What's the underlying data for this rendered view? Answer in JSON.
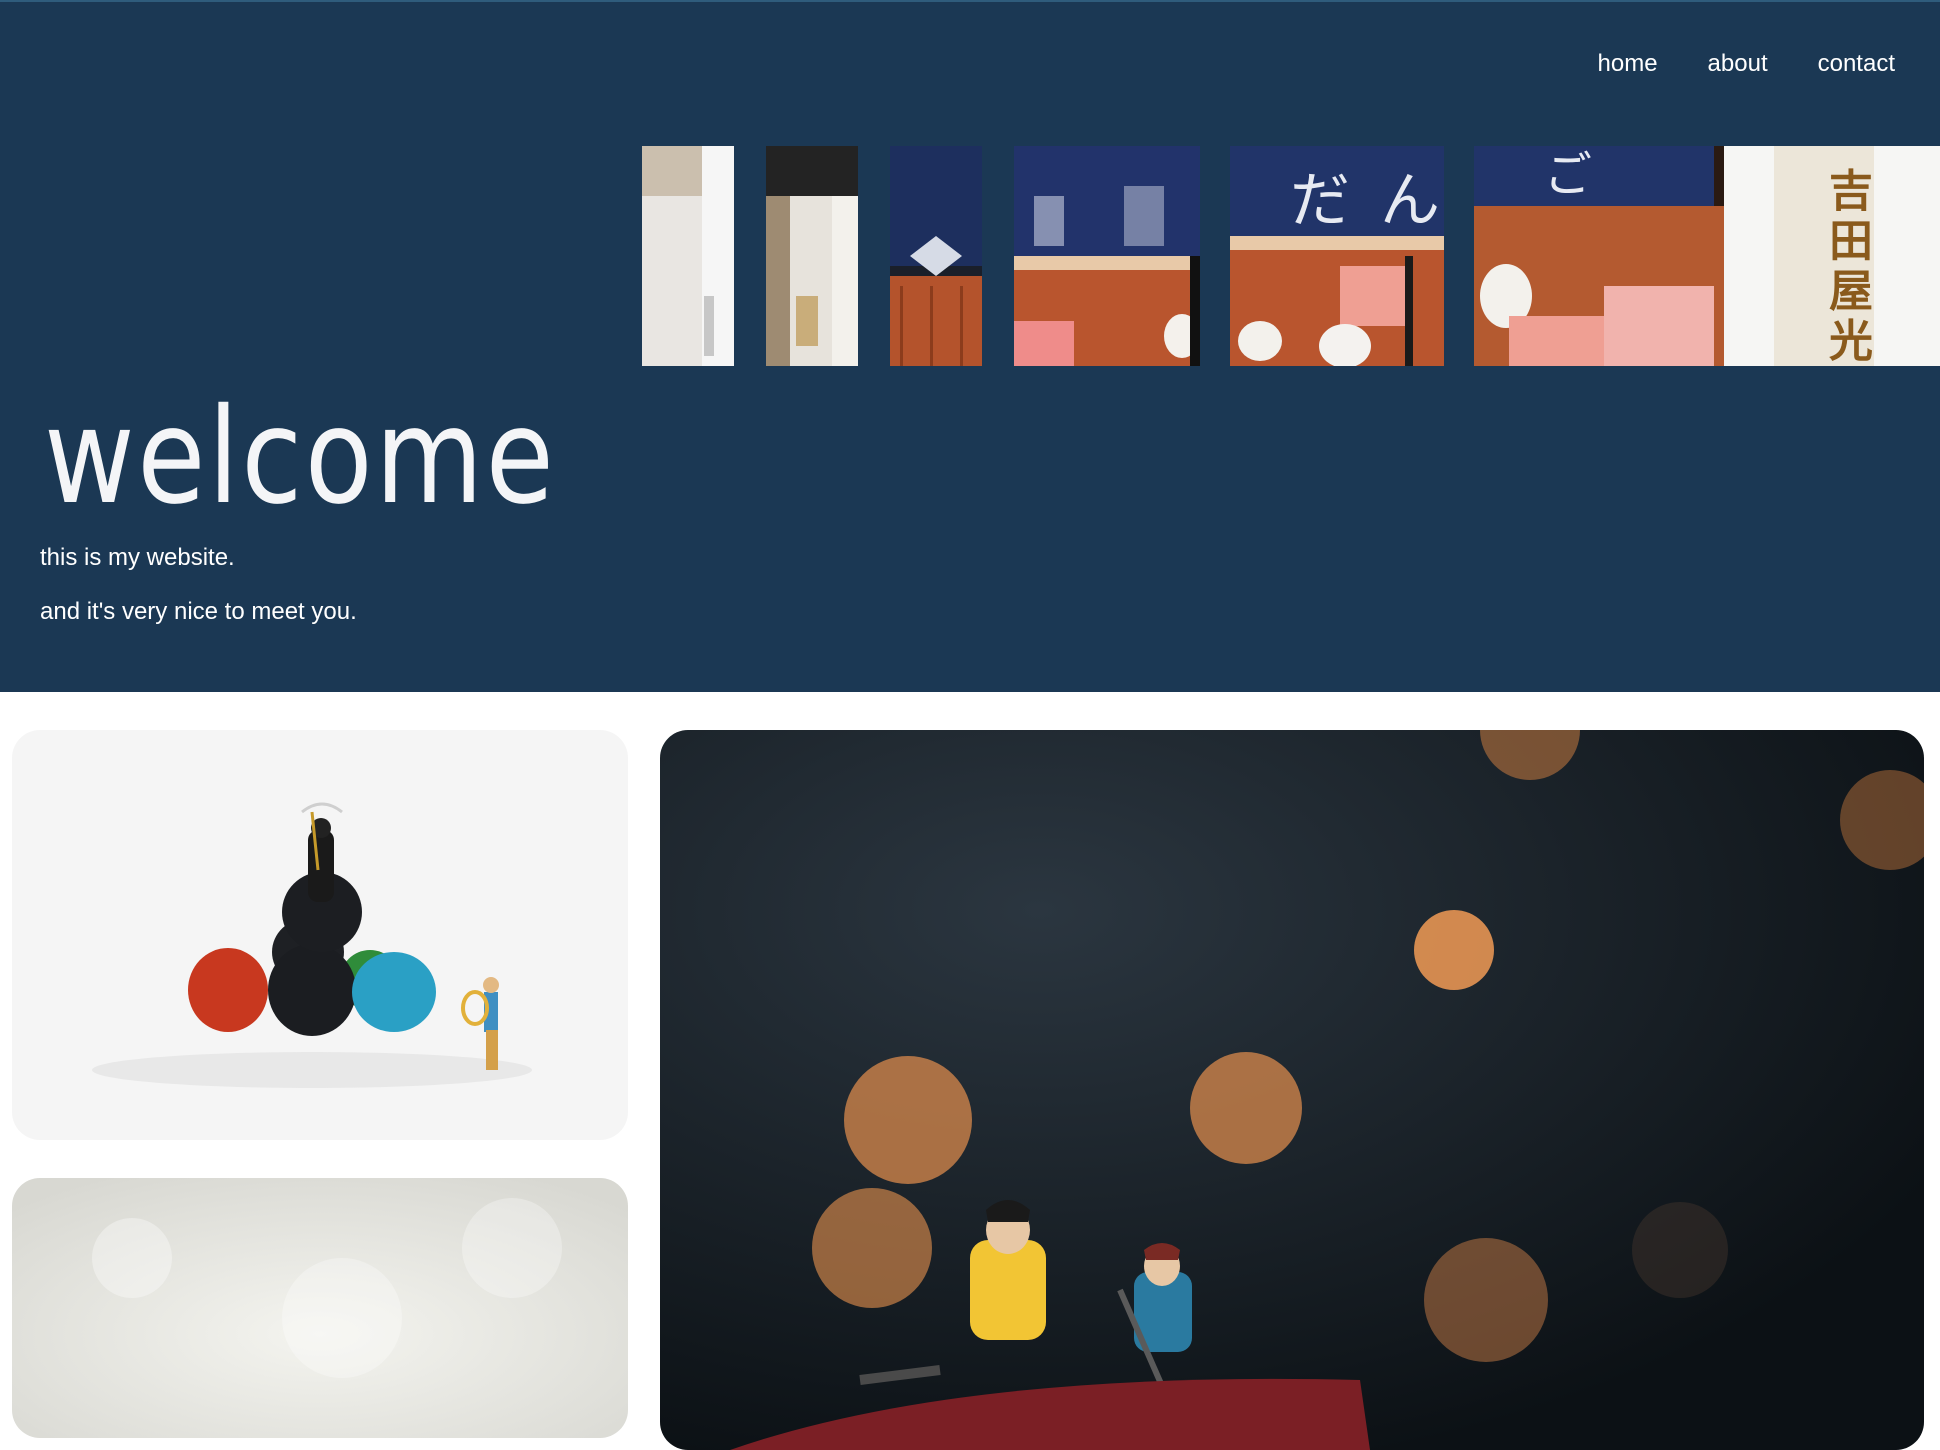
{
  "nav": {
    "items": [
      {
        "label": "home"
      },
      {
        "label": "about"
      },
      {
        "label": "contact"
      }
    ]
  },
  "hero": {
    "title": "welcome",
    "lines": [
      "this is my website.",
      "and it's very nice to meet you."
    ],
    "background": "#1b3854",
    "photo_strip_subject": "miniature japanese dango shop storefront"
  },
  "gallery": {
    "photos": [
      {
        "subject": "miniature grim reaper on gumdrops"
      },
      {
        "subject": "white fluffy texture"
      },
      {
        "subject": "miniature couple rowing boat with orange bokeh"
      }
    ]
  }
}
